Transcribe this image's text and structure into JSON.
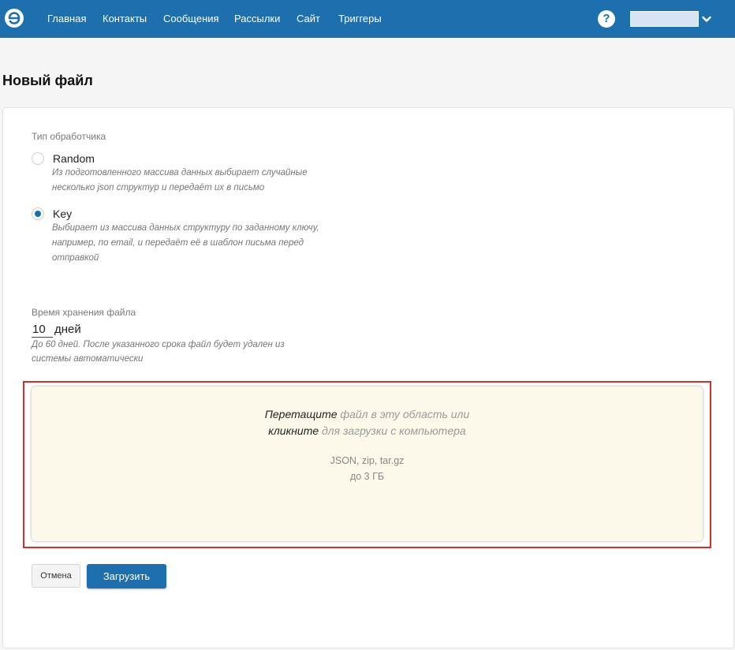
{
  "nav": {
    "items": [
      {
        "label": "Главная"
      },
      {
        "label": "Контакты"
      },
      {
        "label": "Сообщения"
      },
      {
        "label": "Рассылки"
      },
      {
        "label": "Сайт"
      },
      {
        "label": "Триггеры"
      }
    ],
    "help_glyph": "?",
    "logo_icon": "logo-icon",
    "caret_icon": "chevron-down-icon"
  },
  "page": {
    "title": "Новый файл"
  },
  "handler": {
    "label": "Тип обработчика",
    "selected": "Key",
    "options": [
      {
        "label": "Random",
        "description": "Из подготовленного массива данных выбирает случайные несколько json структур и передаёт их в письмо",
        "checked": false
      },
      {
        "label": "Key",
        "description": "Выбирает из массива данных структуру по заданному ключу, например, по email, и передаёт её в шаблон письма перед отправкой",
        "checked": true
      }
    ]
  },
  "storage": {
    "label": "Время хранения файла",
    "value": "10",
    "unit": "дней",
    "hint": "До 60 дней. После указанного срока файл будет удален из системы автоматически"
  },
  "dropzone": {
    "drag_word": "Перетащите",
    "drag_rest": " файл в эту область или",
    "click_word": "кликните",
    "click_rest": " для загрузки с компьютера",
    "formats": "JSON, zip, tar.gz",
    "max_size": "до 3 ГБ"
  },
  "actions": {
    "cancel_label": "Отмена",
    "upload_label": "Загрузить"
  },
  "colors": {
    "accent": "#1e6fae",
    "highlight_border": "#d32f2f",
    "dropzone_bg": "#fdf9ea"
  }
}
